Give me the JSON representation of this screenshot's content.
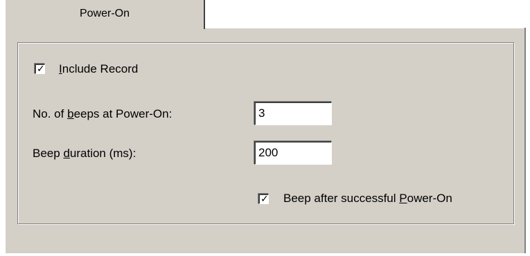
{
  "tab": {
    "label": "Power-On"
  },
  "include_record": {
    "checked_mark": "✓",
    "label_prefix": "",
    "label_accel": "I",
    "label_rest": "nclude Record"
  },
  "beeps": {
    "label_prefix": "No. of ",
    "label_accel": "b",
    "label_rest": "eeps at Power-On:",
    "value": "3"
  },
  "duration": {
    "label_prefix": "Beep ",
    "label_accel": "d",
    "label_rest": "uration (ms):",
    "value": "200"
  },
  "beep_after": {
    "checked_mark": "✓",
    "label_prefix": "Beep after successful ",
    "label_accel": "P",
    "label_rest": "ower-On"
  }
}
